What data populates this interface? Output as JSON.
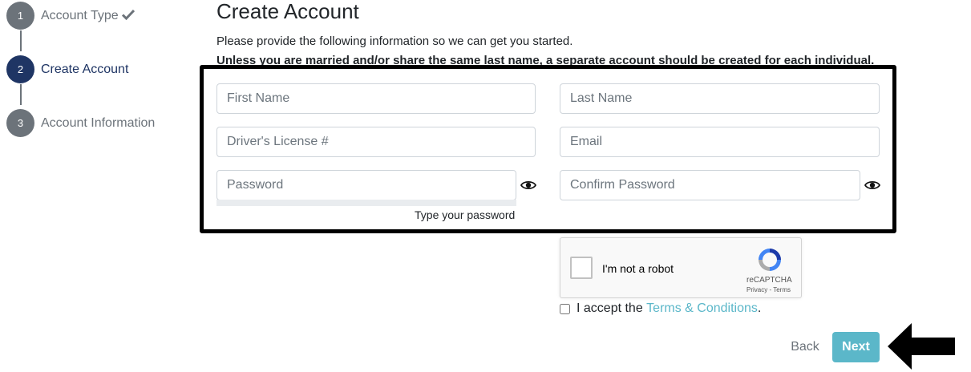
{
  "stepper": {
    "steps": [
      {
        "number": "1",
        "label": "Account Type",
        "icon": "check-icon",
        "state": "complete"
      },
      {
        "number": "2",
        "label": "Create Account",
        "state": "active"
      },
      {
        "number": "3",
        "label": "Account Information",
        "state": "pending"
      }
    ]
  },
  "header": {
    "title": "Create Account",
    "intro": "Please provide the following information so we can get you started.",
    "warning": "Unless you are married and/or share the same last name, a separate account should be created for each individual."
  },
  "form": {
    "first_name": {
      "placeholder": "First Name",
      "value": ""
    },
    "last_name": {
      "placeholder": "Last Name",
      "value": ""
    },
    "drivers_license": {
      "placeholder": "Driver's License #",
      "value": ""
    },
    "email": {
      "placeholder": "Email",
      "value": ""
    },
    "password": {
      "placeholder": "Password",
      "value": "",
      "icon": "eye-icon"
    },
    "confirm_password": {
      "placeholder": "Confirm Password",
      "value": "",
      "icon": "eye-icon"
    },
    "password_hint": "Type your password",
    "password_strength": 0
  },
  "recaptcha": {
    "label": "I'm not a robot",
    "brand": "reCAPTCHA",
    "privacy": "Privacy",
    "separator": " - ",
    "terms": "Terms",
    "checked": false
  },
  "terms": {
    "prefix": "I accept the ",
    "link": "Terms & Conditions",
    "suffix": ".",
    "checked": false
  },
  "actions": {
    "back_label": "Back",
    "next_label": "Next"
  },
  "colors": {
    "accent": "#5bb7c9",
    "active_step": "#1f3564",
    "inactive_step": "#6c737a",
    "annotation": "#000000"
  }
}
